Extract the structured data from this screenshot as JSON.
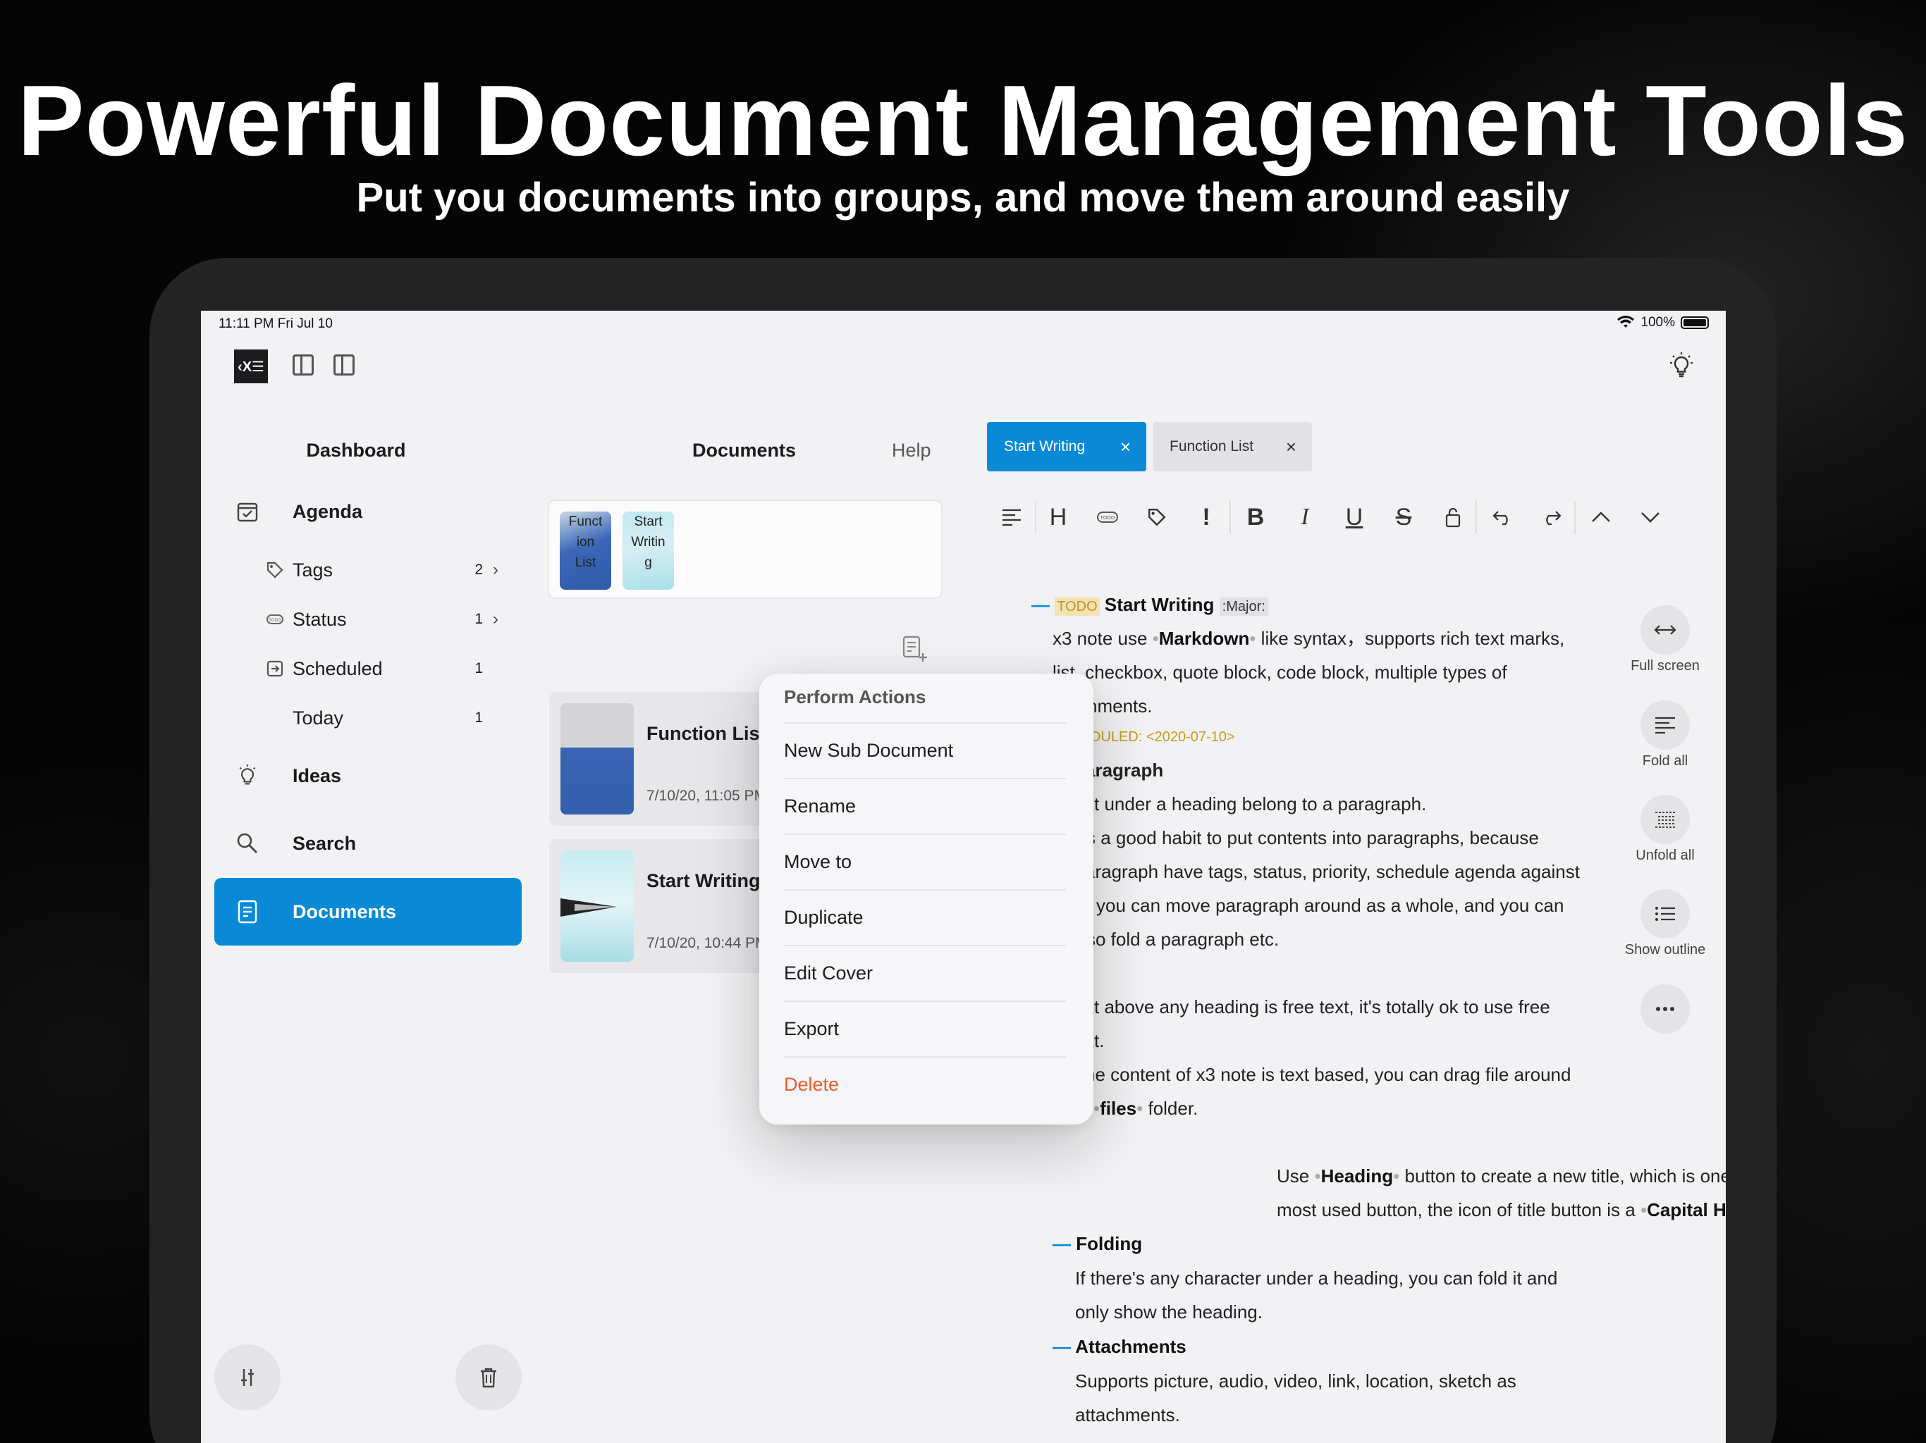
{
  "marketing": {
    "headline": "Powerful Document Management Tools",
    "subline": "Put you documents into groups, and move them around easily"
  },
  "status_bar": {
    "time": "11:11 PM   Fri Jul 10",
    "battery": "100%"
  },
  "toolbar": {
    "logo": "‹X☰"
  },
  "sidebar": {
    "title": "Dashboard",
    "agenda": "Agenda",
    "tags": {
      "label": "Tags",
      "count": "2"
    },
    "status": {
      "label": "Status",
      "count": "1"
    },
    "scheduled": {
      "label": "Scheduled",
      "count": "1"
    },
    "today": {
      "label": "Today",
      "count": "1"
    },
    "ideas": "Ideas",
    "search": "Search",
    "documents": "Documents"
  },
  "documents": {
    "title": "Documents",
    "help": "Help",
    "strip": [
      {
        "label_lines": [
          "Funct",
          "ion",
          "List"
        ]
      },
      {
        "label_lines": [
          "Start",
          "Writin",
          "g"
        ]
      }
    ],
    "cards": [
      {
        "title": "Function List",
        "date": "7/10/20, 11:05 PM"
      },
      {
        "title": "Start Writing",
        "date": "7/10/20, 10:44 PM"
      }
    ]
  },
  "tabs": [
    {
      "label": "Start Writing",
      "active": true
    },
    {
      "label": "Function List",
      "active": false
    }
  ],
  "format_toolbar": [
    "align-icon",
    "heading-icon",
    "todo-icon",
    "tag-icon",
    "priority-icon",
    "bold-icon",
    "italic-icon",
    "underline-icon",
    "strike-icon",
    "lock-icon",
    "undo-icon",
    "redo-icon",
    "up-icon",
    "down-icon"
  ],
  "editor": {
    "todo": "TODO",
    "heading": "Start Writing",
    "major": ":Major:",
    "l1a": "x3 note use ",
    "l1b": "Markdown",
    "l1c": " like syntax，supports rich text marks,",
    "l2": "list, checkbox, quote block, code block, multiple types of",
    "l3": "chments.",
    "l4a": "DULED: <",
    "l4b": "2020-07-10",
    "l4c": ">",
    "paragraph": "aragraph",
    "p1": "xt under a heading belong to a paragraph.",
    "p2": "s a good habit to put contents into paragraphs, because",
    "p3": "aragraph have tags, status, priority, schedule agenda against",
    "p4": "you can move paragraph around as a whole, and you can",
    "p5": "so fold a paragraph etc.",
    "f1": "xt above any heading is free text, it's totally ok to use free",
    "f2": "xt.",
    "f3": "he content of x3 note is text based, you can drag file around",
    "f4a": "files",
    "f4b": " folder.",
    "h1a": "Use ",
    "h1b": "Heading",
    "h1c": " button to create a new title, which is one of the",
    "h2a": "most used button, the icon of title button is a ",
    "h2b": "Capital H",
    "h2c": ".",
    "folding": "Folding",
    "fo1": "If there's any character under a heading, you can fold it and",
    "fo2": "only show the heading.",
    "attachments": "Attachments",
    "at1": "Supports picture, audio, video, link, location, sketch as",
    "at2": "attachments."
  },
  "side_actions": [
    {
      "label": "Full screen"
    },
    {
      "label": "Fold all"
    },
    {
      "label": "Unfold all"
    },
    {
      "label": "Show outline"
    },
    {
      "label": ""
    }
  ],
  "context_menu": {
    "title": "Perform Actions",
    "items": [
      "New Sub Document",
      "Rename",
      "Move to",
      "Duplicate",
      "Edit Cover",
      "Export",
      "Delete"
    ]
  },
  "colors": {
    "accent": "#0a8ad6",
    "delete": "#f05a28",
    "todo": "#c4912a"
  }
}
